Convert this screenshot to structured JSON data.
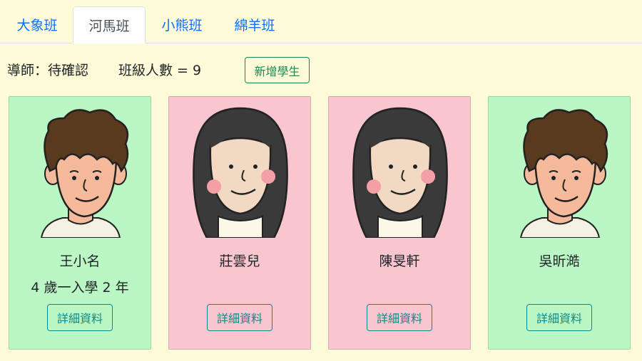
{
  "tabs": [
    {
      "label": "大象班",
      "active": false
    },
    {
      "label": "河馬班",
      "active": true
    },
    {
      "label": "小熊班",
      "active": false
    },
    {
      "label": "綿羊班",
      "active": false
    }
  ],
  "class_info": {
    "teacher": "導師：待確認",
    "student_count": "班級人數 = 9",
    "add_button": "新增學生"
  },
  "students": [
    {
      "name": "王小名",
      "age": "4 歲一入學 2 年",
      "avatar_icon": "boy-avatar-icon",
      "card_color": "#bbf7c4",
      "detail_button": "詳細資料"
    },
    {
      "name": "莊雲兒",
      "age": "",
      "avatar_icon": "girl-avatar-icon",
      "card_color": "#f9c6cf",
      "detail_button": "詳細資料"
    },
    {
      "name": "陳旻軒",
      "age": "",
      "avatar_icon": "girl-avatar-icon",
      "card_color": "#f9c6cf",
      "detail_button": "詳細資料"
    },
    {
      "name": "吳昕澔",
      "age": "",
      "avatar_icon": "boy-avatar-icon",
      "card_color": "#bbf7c4",
      "detail_button": "詳細資料"
    }
  ],
  "colors": {
    "page_background": "#fefbd8",
    "tab_link": "#0d6efd",
    "add_button": "#198754",
    "detail_button": "#0d8a8a"
  }
}
